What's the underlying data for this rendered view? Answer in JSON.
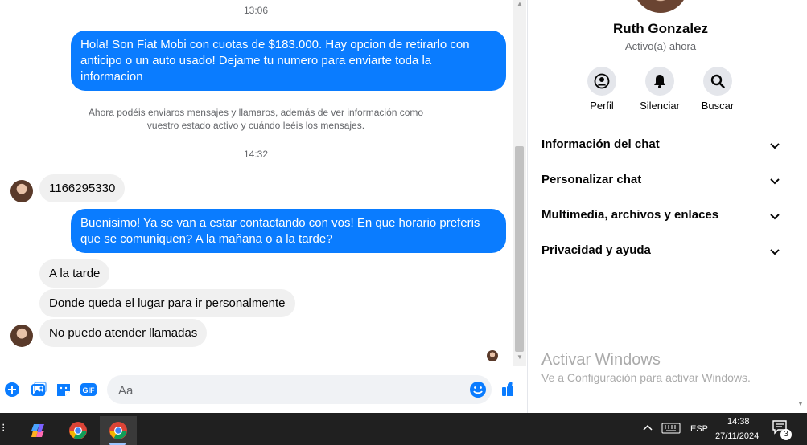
{
  "chat": {
    "timestamp_1": "13:06",
    "msg_out_1": "Hola! Son Fiat Mobi con cuotas de $183.000. Hay opcion de retirarlo con anticipo o un auto usado! Dejame tu numero para enviarte toda la informacion",
    "notice": "Ahora podéis enviaros mensajes y llamaros, además de ver información como vuestro estado activo y cuándo leéis los mensajes.",
    "timestamp_2": "14:32",
    "msg_in_1": "1166295330",
    "msg_out_2": "Buenisimo! Ya se van a estar contactando con vos! En que horario preferis que se comuniquen? A la mañana o a la tarde?",
    "msg_in_2": "A la tarde",
    "msg_in_3": "Donde queda el lugar para ir personalmente",
    "msg_in_4": "No puedo atender llamadas"
  },
  "composer": {
    "placeholder": "Aa",
    "icons": [
      "plus-icon",
      "photo-icon",
      "sticker-icon",
      "gif-icon",
      "emoji-icon",
      "like-icon"
    ]
  },
  "sidebar": {
    "name": "Ruth Gonzalez",
    "status": "Activo(a) ahora",
    "actions": {
      "profile": "Perfil",
      "mute": "Silenciar",
      "search": "Buscar"
    },
    "sections": {
      "chat_info": "Información del chat",
      "customize": "Personalizar chat",
      "media": "Multimedia, archivos y enlaces",
      "privacy": "Privacidad y ayuda"
    },
    "watermark_title": "Activar Windows",
    "watermark_sub": "Ve a Configuración para activar Windows."
  },
  "taskbar": {
    "language": "ESP",
    "time": "14:38",
    "date": "27/11/2024",
    "notifications": "3"
  },
  "colors": {
    "outgoing": "#0a7cff",
    "incoming": "#f0f0f0",
    "accent": "#0a7cff"
  }
}
